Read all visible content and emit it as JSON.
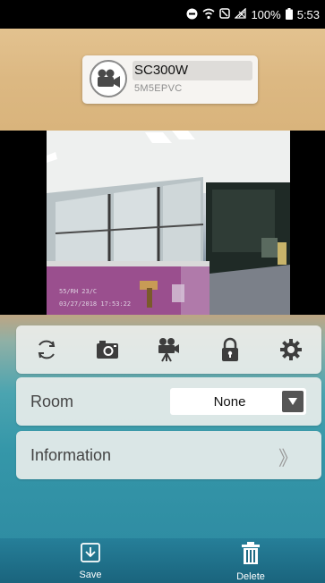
{
  "status_bar": {
    "battery": "100%",
    "time": "5:53"
  },
  "camera": {
    "name": "SC300W",
    "id": "5M5EPVC",
    "icon": "video-camera-icon"
  },
  "video": {
    "osd_line1": "55/RH    23/C",
    "osd_line2": "03/27/2018  17:53:22"
  },
  "toolbar": {
    "icons": [
      "refresh-icon",
      "snapshot-camera-icon",
      "record-video-icon",
      "lock-icon",
      "settings-gear-icon"
    ]
  },
  "room": {
    "label": "Room",
    "selected": "None"
  },
  "information": {
    "label": "Information",
    "chevron": "》"
  },
  "bottom_bar": {
    "save_label": "Save",
    "delete_label": "Delete"
  },
  "colors": {
    "header": "#dcb882",
    "panel": "#3597a9",
    "bottom_bar": "#1e6f8a",
    "icon": "#3d3d3d"
  }
}
